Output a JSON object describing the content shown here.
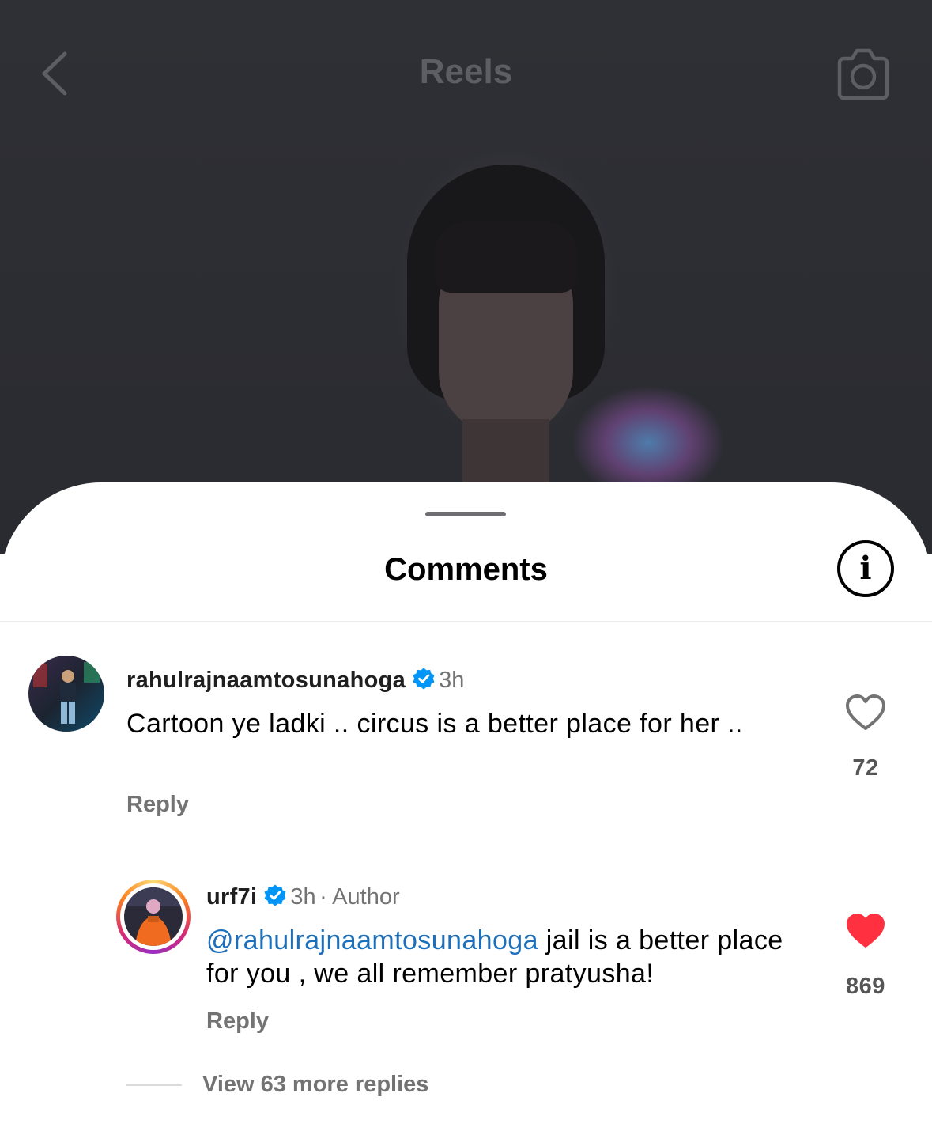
{
  "reel_header": {
    "title": "Reels",
    "back_icon": "chevron-left-icon",
    "camera_icon": "camera-icon"
  },
  "sheet": {
    "title": "Comments",
    "info_icon": "info-icon"
  },
  "comments": [
    {
      "username": "rahulrajnaamtosunahoga",
      "verified": true,
      "time": "3h",
      "text": "Cartoon ye ladki .. circus is a better place for her ..",
      "reply_label": "Reply",
      "likes": "72",
      "liked": false
    }
  ],
  "replies": [
    {
      "username": "urf7i",
      "verified": true,
      "time": "3h",
      "author_tag": "· Author",
      "mention": "@rahulrajnaamtosunahoga",
      "text": " jail is a better place for you , we all remember pratyusha!",
      "reply_label": "Reply",
      "likes": "869",
      "liked": true
    }
  ],
  "view_more_replies": "View 63 more replies",
  "colors": {
    "like_red": "#ff3040",
    "verified_blue": "#0095f6",
    "mention_blue": "#1c6fb8",
    "muted_gray": "#737373"
  }
}
